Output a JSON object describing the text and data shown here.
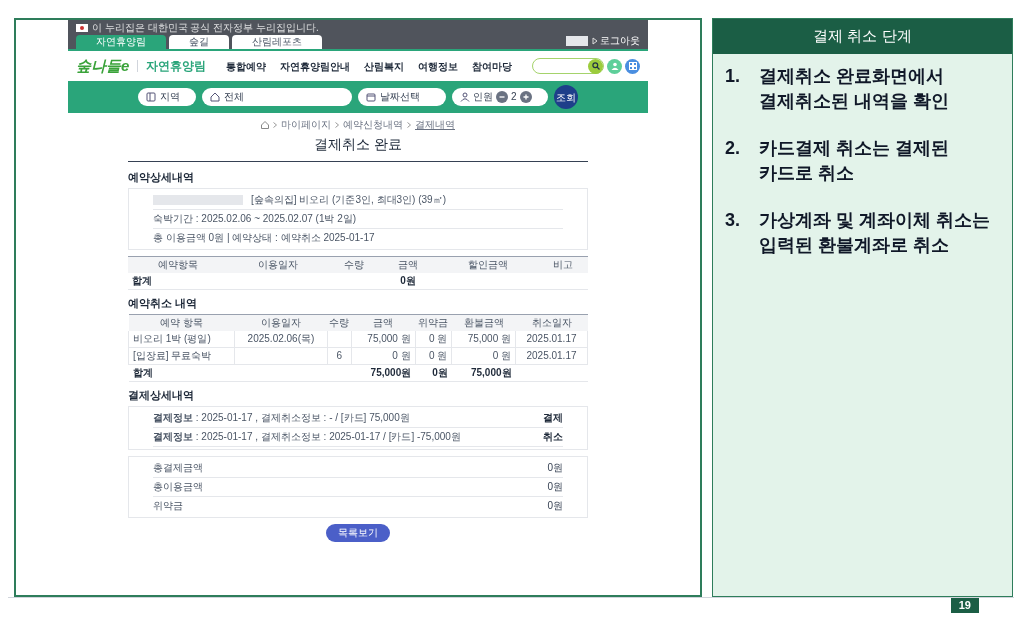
{
  "gov_notice": "이 누리집은 대한민국 공식 전자정부 누리집입니다.",
  "site_tabs": [
    {
      "label": "자연휴양림",
      "selected": true
    },
    {
      "label": "숲길",
      "selected": false
    },
    {
      "label": "산림레포츠",
      "selected": false
    }
  ],
  "logout": "로그아웃",
  "logo": {
    "brand": "숲나들e",
    "section": "자연휴양림"
  },
  "nav": [
    "통합예약",
    "자연휴양림안내",
    "산림복지",
    "여행정보",
    "참여마당"
  ],
  "search_bar": {
    "fields": [
      {
        "kind": "region",
        "label": "지역"
      },
      {
        "kind": "home",
        "label": "전체"
      },
      {
        "kind": "date",
        "label": "날짜선택"
      }
    ],
    "guests": {
      "label": "인원",
      "count": "2"
    },
    "button": "조회"
  },
  "breadcrumb": [
    "마이페이지",
    "예약신청내역",
    "결제내역"
  ],
  "page_title": "결제취소 완료",
  "reservation": {
    "heading": "예약상세내역",
    "room": "[숲속의집] 비오리 (기준3인, 최대3인) (39㎡)",
    "lines": [
      "숙박기간 : 2025.02.06 ~ 2025.02.07 (1박 2일)",
      "총 이용금액 0원 | 예약상태 : 예약취소 2025-01-17"
    ]
  },
  "items_table": {
    "columns": [
      "예약항목",
      "이용일자",
      "수량",
      "금액",
      "할인금액",
      "비고"
    ],
    "rows": [
      {
        "kind": "total",
        "item": "합계",
        "amount": "0원"
      }
    ]
  },
  "cancel": {
    "heading": "예약취소 내역",
    "columns": [
      "예약 항목",
      "이용일자",
      "수량",
      "금액",
      "위약금",
      "환불금액",
      "취소일자"
    ],
    "rows": [
      {
        "kind": "item",
        "item": "비오리 1박 (평일)",
        "date": "2025.02.06(목)",
        "amount": "75,000 원",
        "penalty": "0 원",
        "refund": "75,000 원",
        "cancel_date": "2025.01.17"
      },
      {
        "kind": "item",
        "item": "[입장료] 무료숙박",
        "qty": "6",
        "amount": "0 원",
        "penalty": "0 원",
        "refund": "0 원",
        "cancel_date": "2025.01.17"
      },
      {
        "kind": "total",
        "item": "합계",
        "amount": "75,000원",
        "penalty": "0원",
        "refund": "75,000원"
      }
    ]
  },
  "payment": {
    "heading": "결제상세내역",
    "entries": [
      {
        "text": "**결제정보** : 2025-01-17 , 결제취소정보 : - / [카드] 75,000원",
        "status": "결제"
      },
      {
        "text": "**결제정보** : 2025-01-17 , 결제취소정보 : 2025-01-17 / [카드] -75,000원",
        "status": "취소"
      }
    ],
    "summary": [
      {
        "label": "총결제금액",
        "value": "0원"
      },
      {
        "label": "총이용금액",
        "value": "0원"
      },
      {
        "label": "위약금",
        "value": "0원"
      }
    ]
  },
  "list_button": "목록보기",
  "guide": {
    "title": "결제 취소 단계",
    "steps": [
      {
        "number": "1.",
        "lines": [
          "결제취소 완료화면에서",
          "결제취소된 내역을 확인"
        ]
      },
      {
        "number": "2.",
        "lines": [
          "카드결제 취소는 결제된",
          "카드로 취소"
        ]
      },
      {
        "number": "3.",
        "lines": [
          "가상계좌 및 계좌이체 취소는",
          "입력된 환불계좌로 취소"
        ]
      }
    ]
  },
  "page_number": "19"
}
